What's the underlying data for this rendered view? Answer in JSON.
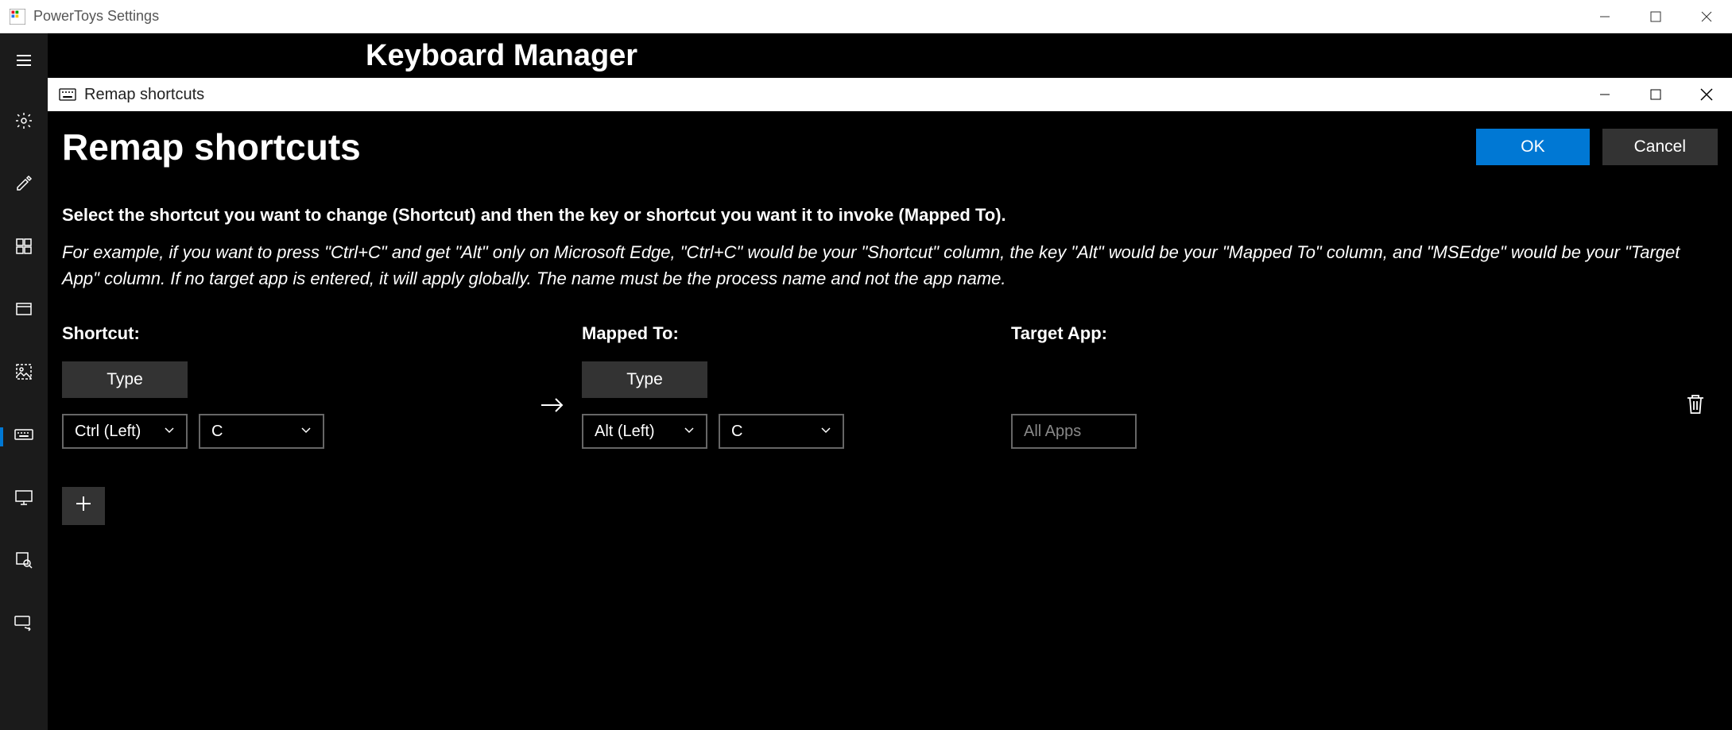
{
  "window": {
    "title": "PowerToys Settings"
  },
  "page": {
    "title": "Keyboard Manager"
  },
  "dialog": {
    "title": "Remap shortcuts",
    "heading": "Remap shortcuts",
    "ok_label": "OK",
    "cancel_label": "Cancel",
    "instructions": "Select the shortcut you want to change (Shortcut) and then the key or shortcut you want it to invoke (Mapped To).",
    "example": "For example, if you want to press \"Ctrl+C\" and get \"Alt\" only on Microsoft Edge, \"Ctrl+C\" would be your \"Shortcut\" column, the key \"Alt\" would be your \"Mapped To\" column, and \"MSEdge\" would be your \"Target App\" column. If no target app is entered, it will apply globally. The name must be the process name and not the app name.",
    "columns": {
      "shortcut": "Shortcut:",
      "mapped": "Mapped To:",
      "target": "Target App:"
    },
    "type_label": "Type",
    "row": {
      "shortcut_modifier": "Ctrl (Left)",
      "shortcut_key": "C",
      "mapped_modifier": "Alt (Left)",
      "mapped_key": "C",
      "target_placeholder": "All Apps"
    },
    "add_label": "+"
  }
}
